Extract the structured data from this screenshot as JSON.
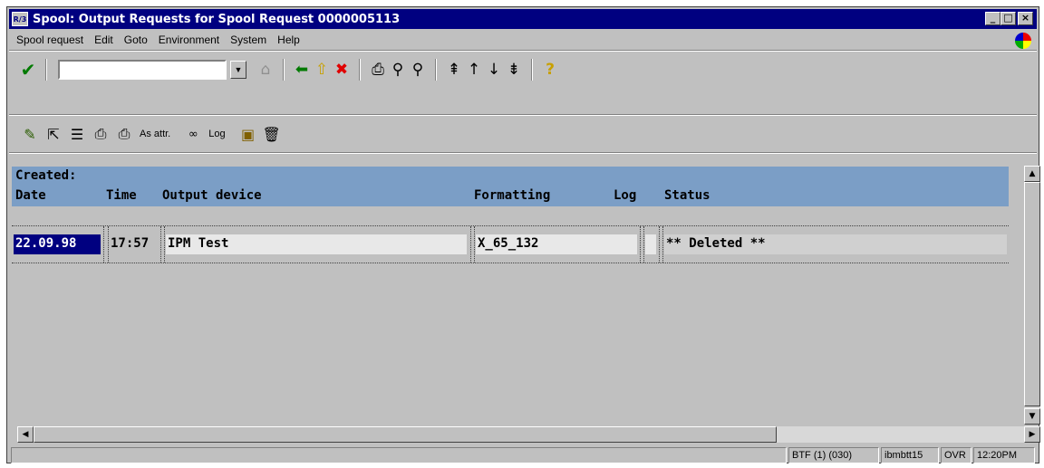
{
  "window": {
    "title": "Spool: Output Requests for Spool Request 0000005113",
    "icon_text": "R/3",
    "buttons": {
      "minimize": "_",
      "maximize": "□",
      "close": "×"
    }
  },
  "menubar": {
    "items": [
      "Spool request",
      "Edit",
      "Goto",
      "Environment",
      "System",
      "Help"
    ]
  },
  "toolbar": {
    "command_value": "",
    "dropdown_icon": "▼"
  },
  "app_toolbar": {
    "as_attr_label": "As attr.",
    "log_label": "Log"
  },
  "table": {
    "created_label": "Created:",
    "headers": {
      "date": "Date",
      "time": "Time",
      "output_device": "Output device",
      "formatting": "Formatting",
      "log": "Log",
      "status": "Status"
    },
    "rows": [
      {
        "date": "22.09.98",
        "time": "17:57",
        "output_device": "IPM Test",
        "formatting": "X_65_132",
        "log": "",
        "status": "** Deleted **"
      }
    ]
  },
  "statusbar": {
    "system": "BTF (1) (030)",
    "server": "ibmbtt15",
    "mode": "OVR",
    "time": "12:20PM"
  },
  "colors": {
    "title_bg": "#000080",
    "header_bg": "#7b9ec6",
    "window_bg": "#c0c0c0",
    "selection_bg": "#000080"
  }
}
